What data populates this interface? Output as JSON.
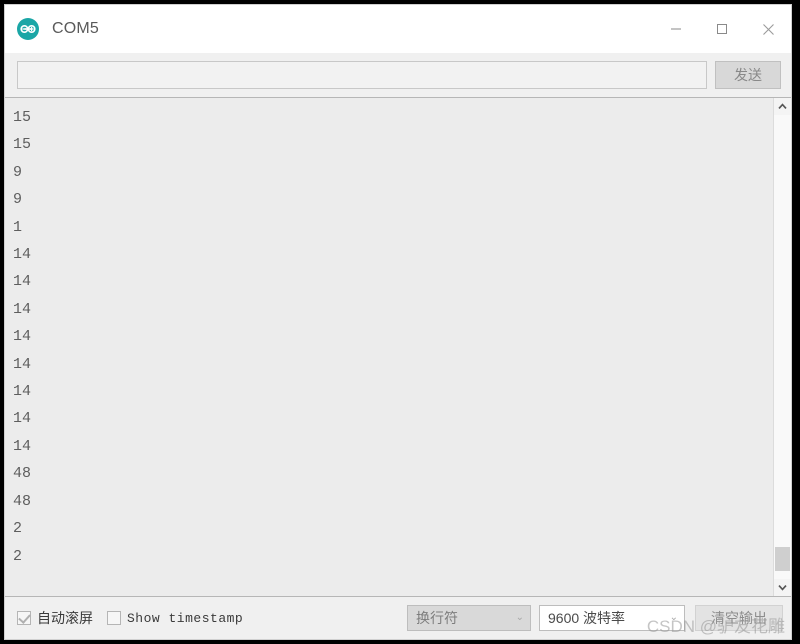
{
  "window": {
    "title": "COM5",
    "app_icon": "arduino-logo-icon",
    "controls": {
      "minimize": "minimize-icon",
      "maximize": "maximize-icon",
      "close": "close-icon"
    }
  },
  "send_row": {
    "input_value": "",
    "input_placeholder": "",
    "send_label": "发送"
  },
  "output": {
    "lines": [
      "15",
      "15",
      "9",
      "9",
      "1",
      "14",
      "14",
      "14",
      "14",
      "14",
      "14",
      "14",
      "14",
      "48",
      "48",
      "2",
      "2"
    ],
    "text": "15\n15\n9\n9\n1\n14\n14\n14\n14\n14\n14\n14\n14\n48\n48\n2\n2"
  },
  "scrollbar": {
    "up_arrow": "chevron-up-icon",
    "down_arrow": "chevron-down-icon",
    "thumb_position": "near-bottom"
  },
  "bottom_bar": {
    "autoscroll_label": "自动滚屏",
    "autoscroll_checked": true,
    "timestamp_label": "Show timestamp",
    "timestamp_checked": false,
    "line_ending": "换行符",
    "baud_rate": "9600 波特率",
    "clear_label": "清空输出",
    "caret_glyph": "⌄"
  },
  "watermark": {
    "text": "CSDN @驴友花雕"
  },
  "colors": {
    "accent_teal": "#00979c",
    "window_bg": "#f0f0f0",
    "output_bg": "#ececec",
    "output_text": "#5e5e5e"
  }
}
